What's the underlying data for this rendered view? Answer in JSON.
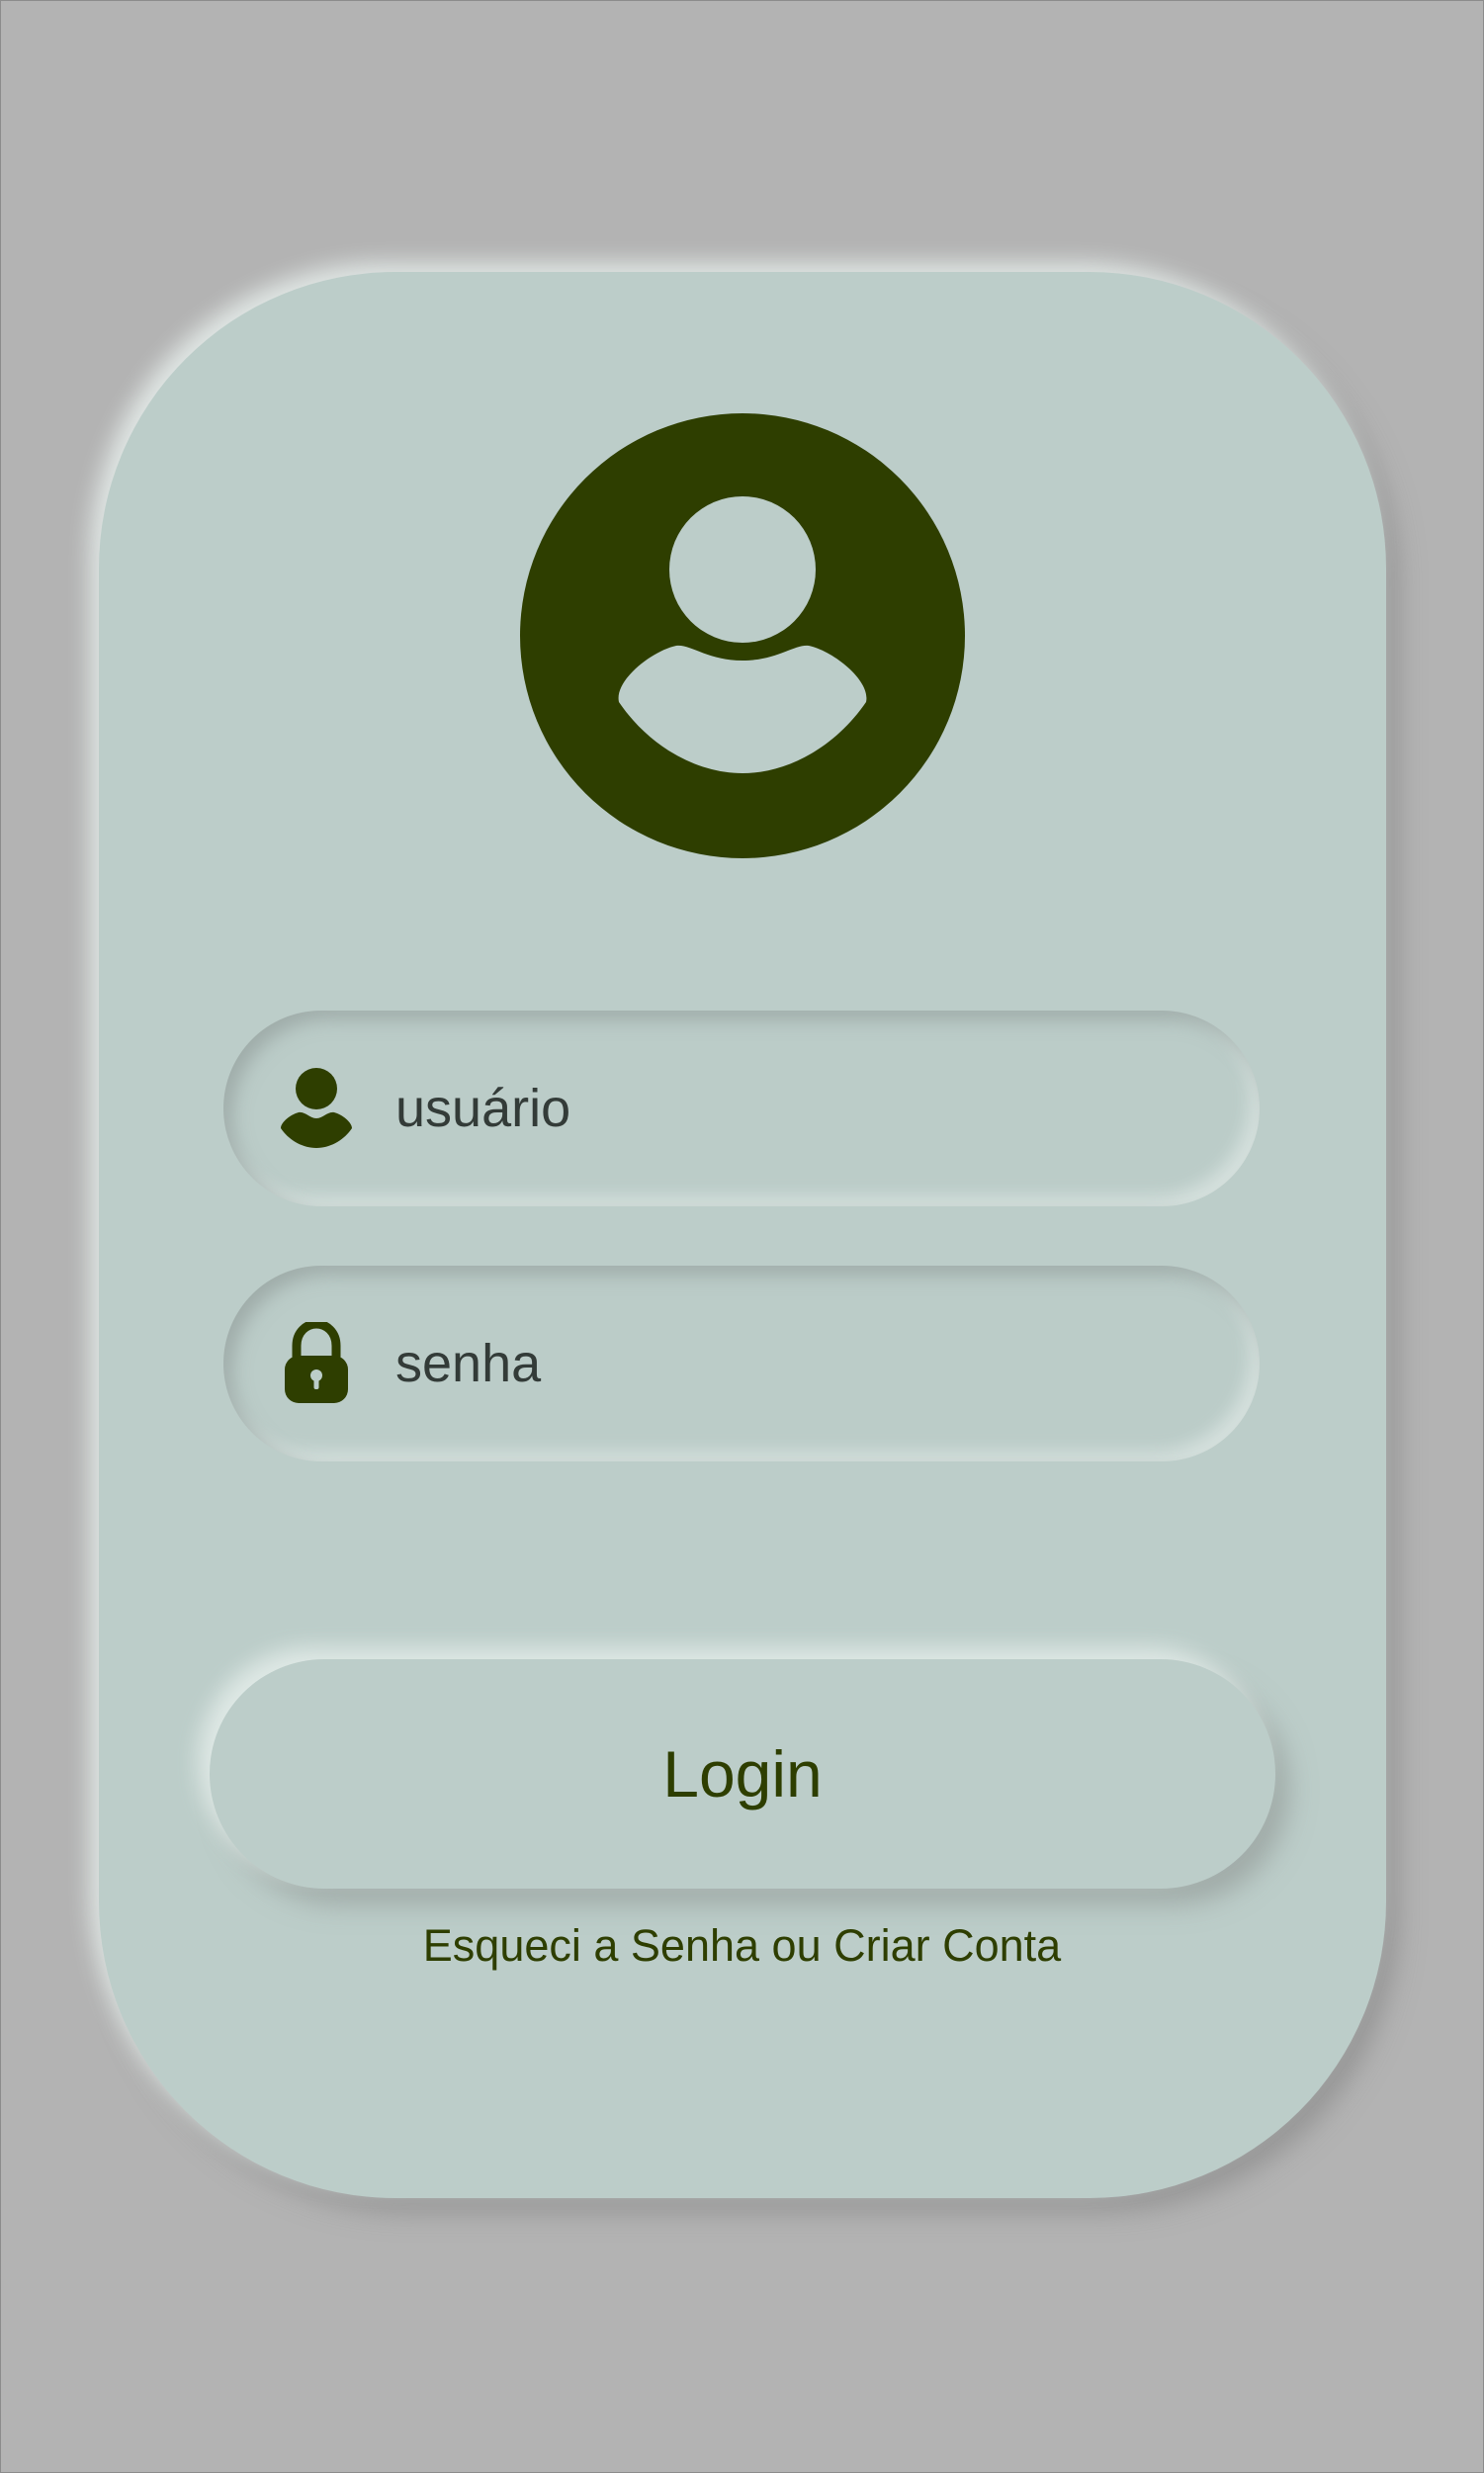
{
  "login": {
    "username_placeholder": "usuário",
    "password_placeholder": "senha",
    "login_label": "Login"
  },
  "links": {
    "forgot_password": "Esqueci a Senha",
    "separator": " ou ",
    "create_account": "Criar Conta"
  },
  "icons": {
    "avatar": "user-circle-icon",
    "username": "user-icon",
    "password": "lock-icon"
  },
  "colors": {
    "background": "#b3b3b3",
    "card": "#bccdc9",
    "accent": "#2e3e00",
    "input_text": "#333b38"
  }
}
